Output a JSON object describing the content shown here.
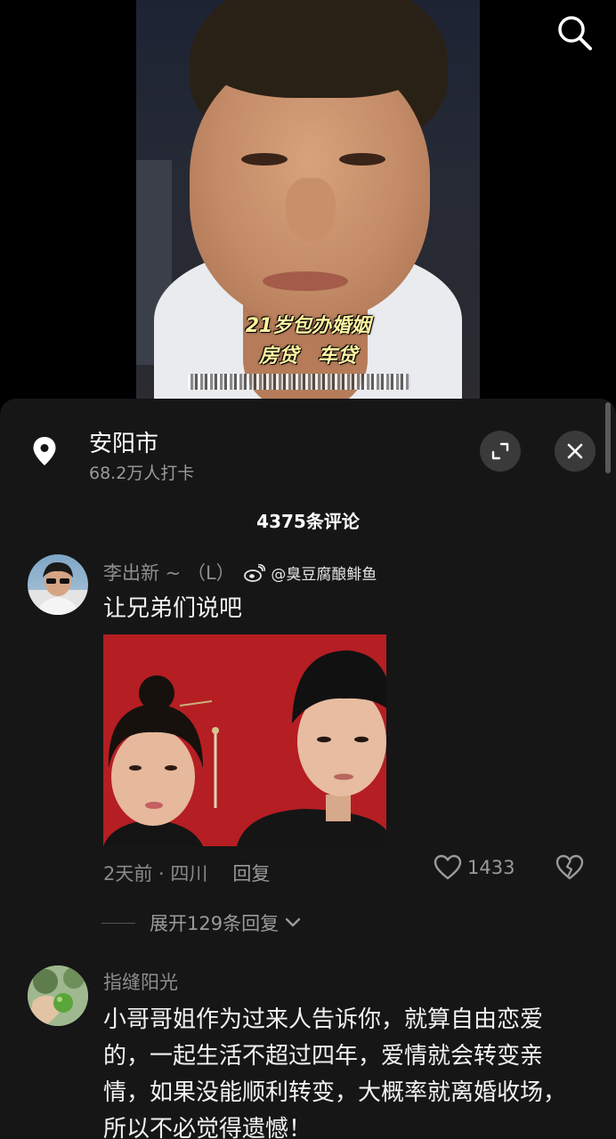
{
  "video": {
    "caption_line1": "21岁包办婚姻",
    "caption_line2_a": "房贷",
    "caption_line2_b": "车贷",
    "search_icon": "search-icon"
  },
  "location": {
    "name": "安阳市",
    "count": "68.2万人打卡",
    "pin_icon": "location-pin-icon",
    "expand_icon": "expand-icon",
    "close_icon": "close-icon"
  },
  "comments_header": "4375条评论",
  "comments": [
    {
      "author": "李出新 ~ （L）",
      "weibo_handle": "@臭豆腐酿鲱鱼",
      "text": "让兄弟们说吧",
      "time": "2天前 · 四川",
      "reply_label": "回复",
      "likes": "1433",
      "expand_replies": "展开129条回复"
    },
    {
      "author": "指缝阳光",
      "text": "小哥哥姐作为过来人告诉你，就算自由恋爱的，一起生活不超过四年，爱情就会转变亲情，如果没能顺利转变，大概率就离婚收场，所以不必觉得遗憾！"
    }
  ],
  "colors": {
    "sheet_bg": "#161616",
    "caption": "#fff3a0",
    "photo_red": "#b51e22"
  }
}
